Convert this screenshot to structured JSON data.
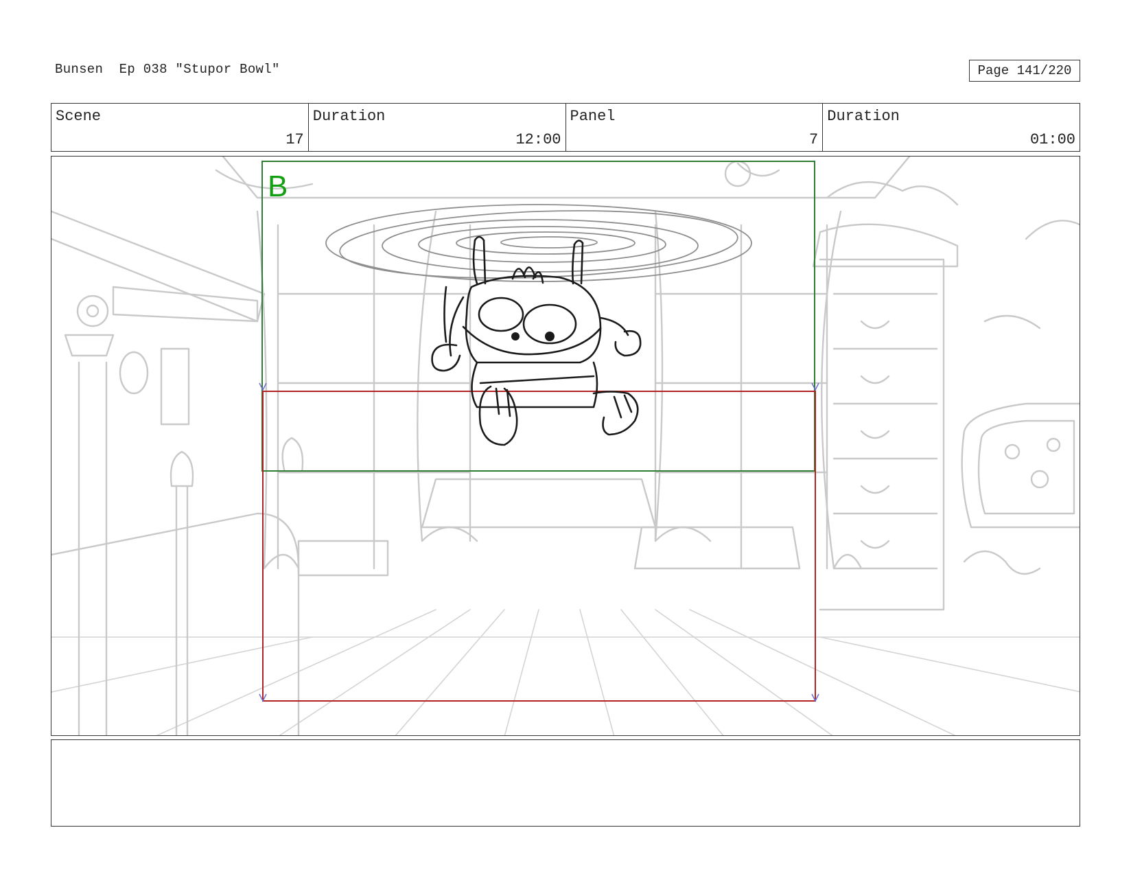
{
  "header": {
    "title": "Bunsen  Ep 038 \"Stupor Bowl\"",
    "page": "Page 141/220"
  },
  "info": [
    {
      "label": "Scene",
      "value": "17"
    },
    {
      "label": "Duration",
      "value": "12:00"
    },
    {
      "label": "Panel",
      "value": "7"
    },
    {
      "label": "Duration",
      "value": "01:00"
    }
  ],
  "panel": {
    "frame_label": "B",
    "frame_b_color": "#2e7d32",
    "frame_label_color": "#12a012",
    "frame_a_color": "#b22222"
  },
  "notes": {
    "text": ""
  }
}
